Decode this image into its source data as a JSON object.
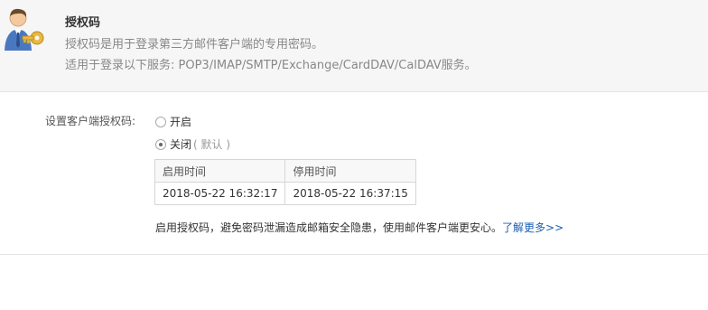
{
  "header": {
    "title": "授权码",
    "description_line1": "授权码是用于登录第三方邮件客户端的专用密码。",
    "description_line2": "适用于登录以下服务: POP3/IMAP/SMTP/Exchange/CardDAV/CalDAV服务。",
    "icon": "user-key-icon"
  },
  "settings": {
    "label": "设置客户端授权码:",
    "options": [
      {
        "label": "开启",
        "checked": false
      },
      {
        "label": "关闭",
        "hint": "( 默认 )",
        "checked": true
      }
    ]
  },
  "time_table": {
    "headers": [
      "启用时间",
      "停用时间"
    ],
    "rows": [
      [
        "2018-05-22 16:32:17",
        "2018-05-22 16:37:15"
      ]
    ]
  },
  "notice": {
    "text": "启用授权码，避免密码泄漏造成邮箱安全隐患，使用邮件客户端更安心。",
    "link_label": "了解更多>>"
  },
  "colors": {
    "link": "#1a5fb4",
    "header_bg": "#f6f6f6",
    "muted_text": "#888888"
  }
}
